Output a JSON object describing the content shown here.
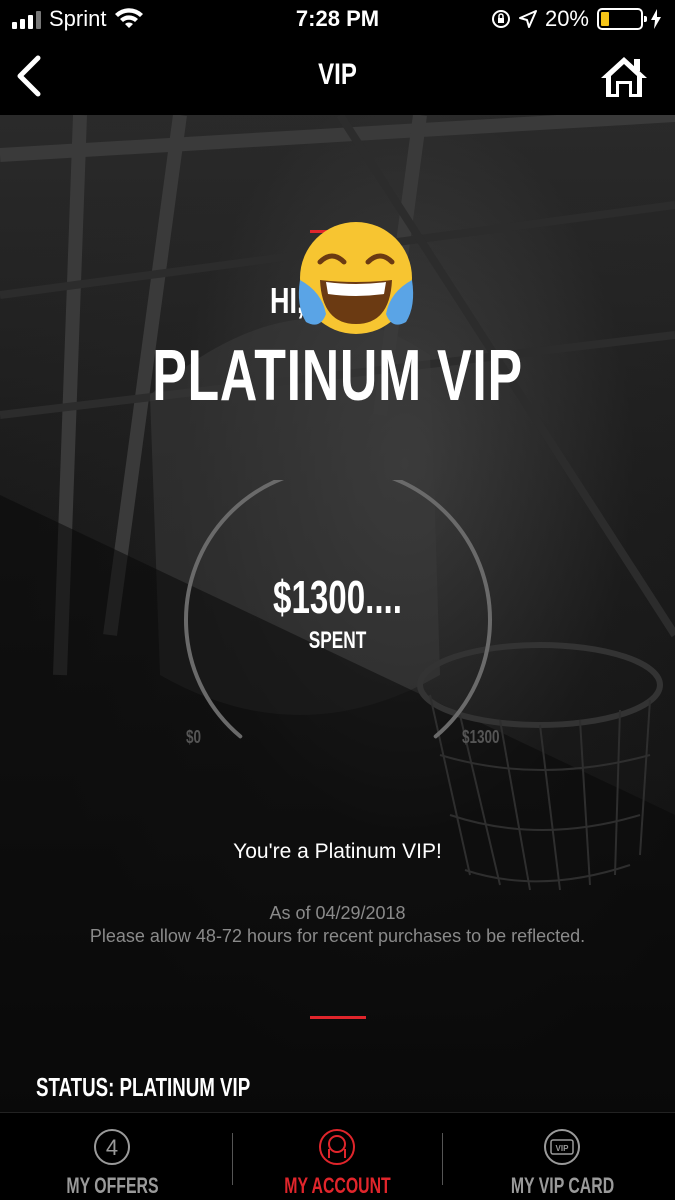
{
  "status_bar": {
    "carrier": "Sprint",
    "time": "7:28 PM",
    "battery": "20%",
    "battery_level": 0.2
  },
  "nav": {
    "title": "VIP",
    "back_icon": "chevron-left-icon",
    "home_icon": "home-icon"
  },
  "greeting": {
    "hi": "HI,",
    "emoji": "face-with-tears-of-joy"
  },
  "tier": "PLATINUM VIP",
  "gauge": {
    "amount": "$1300....",
    "spent_label": "SPENT",
    "min_label": "$0",
    "max_label": "$1300",
    "progress": 1.0
  },
  "message": "You're a Platinum VIP!",
  "as_of": "As of 04/29/2018",
  "allow_note": "Please allow 48-72 hours for recent purchases to be reflected.",
  "status_line": "STATUS: PLATINUM VIP",
  "tabs": [
    {
      "label": "MY OFFERS",
      "badge": "4",
      "icon": "offers-count-icon",
      "active": false
    },
    {
      "label": "MY ACCOUNT",
      "icon": "account-icon",
      "active": true
    },
    {
      "label": "MY VIP CARD",
      "badge": "VIP",
      "icon": "vip-card-icon",
      "active": false
    }
  ],
  "colors": {
    "accent": "#e0252b",
    "battery": "#f5c518"
  }
}
